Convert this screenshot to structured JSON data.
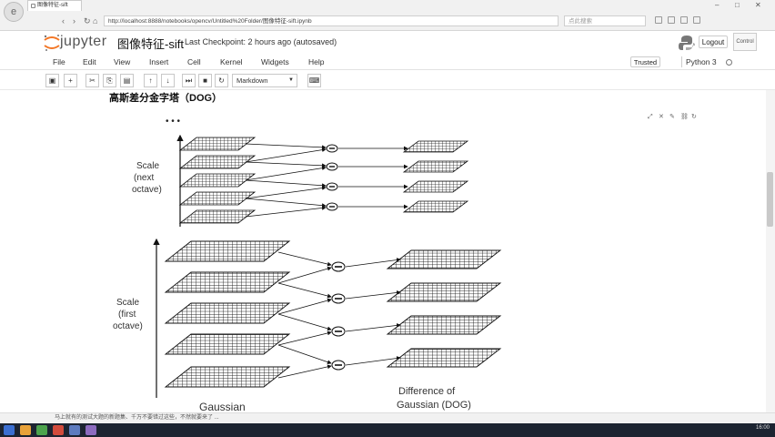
{
  "browser": {
    "tab_title": "图像特征-sift",
    "url": "http://localhost:8888/notebooks/opencv/Untitled%20Folder/图像特征-sift.ipynb",
    "search_placeholder": "点此搜索"
  },
  "jupyter": {
    "brand": "jupyter",
    "notebook_title": "图像特征-sift",
    "checkpoint": "Last Checkpoint: 2 hours ago (autosaved)",
    "logout_label": "Logout",
    "side_label": "Control"
  },
  "menu": [
    "File",
    "Edit",
    "View",
    "Insert",
    "Cell",
    "Kernel",
    "Widgets",
    "Help"
  ],
  "trusted_label": "Trusted",
  "kernel_name": "Python 3",
  "toolbar": {
    "buttons": [
      {
        "icon": "save-icon",
        "glyph": "▣"
      },
      {
        "icon": "plus-icon",
        "glyph": "+"
      },
      {
        "icon": "cut-icon",
        "glyph": "✂"
      },
      {
        "icon": "copy-icon",
        "glyph": "⎘"
      },
      {
        "icon": "paste-icon",
        "glyph": "▤"
      },
      {
        "icon": "arrow-up-icon",
        "glyph": "↑"
      },
      {
        "icon": "arrow-down-icon",
        "glyph": "↓"
      },
      {
        "icon": "run-icon",
        "glyph": "⏭"
      },
      {
        "icon": "stop-icon",
        "glyph": "■"
      },
      {
        "icon": "restart-icon",
        "glyph": "↻"
      },
      {
        "icon": "keyboard-icon",
        "glyph": "⌨"
      }
    ],
    "cell_type": "Markdown"
  },
  "cell": {
    "heading": "高斯差分金字塔（DOG）"
  },
  "diagram": {
    "dots": "• • •",
    "label_next": [
      "Scale",
      "(next",
      "octave)"
    ],
    "label_first": [
      "Scale",
      "(first",
      "octave)"
    ],
    "label_gaussian": "Gaussian",
    "label_dog": [
      "Difference of",
      "Gaussian (DOG)"
    ],
    "minus": "−"
  },
  "statusbar": {
    "left": "马上就有的测试大题的新题集、千万不要错过这些，不然就要来了 ..."
  },
  "clock": "16:00"
}
